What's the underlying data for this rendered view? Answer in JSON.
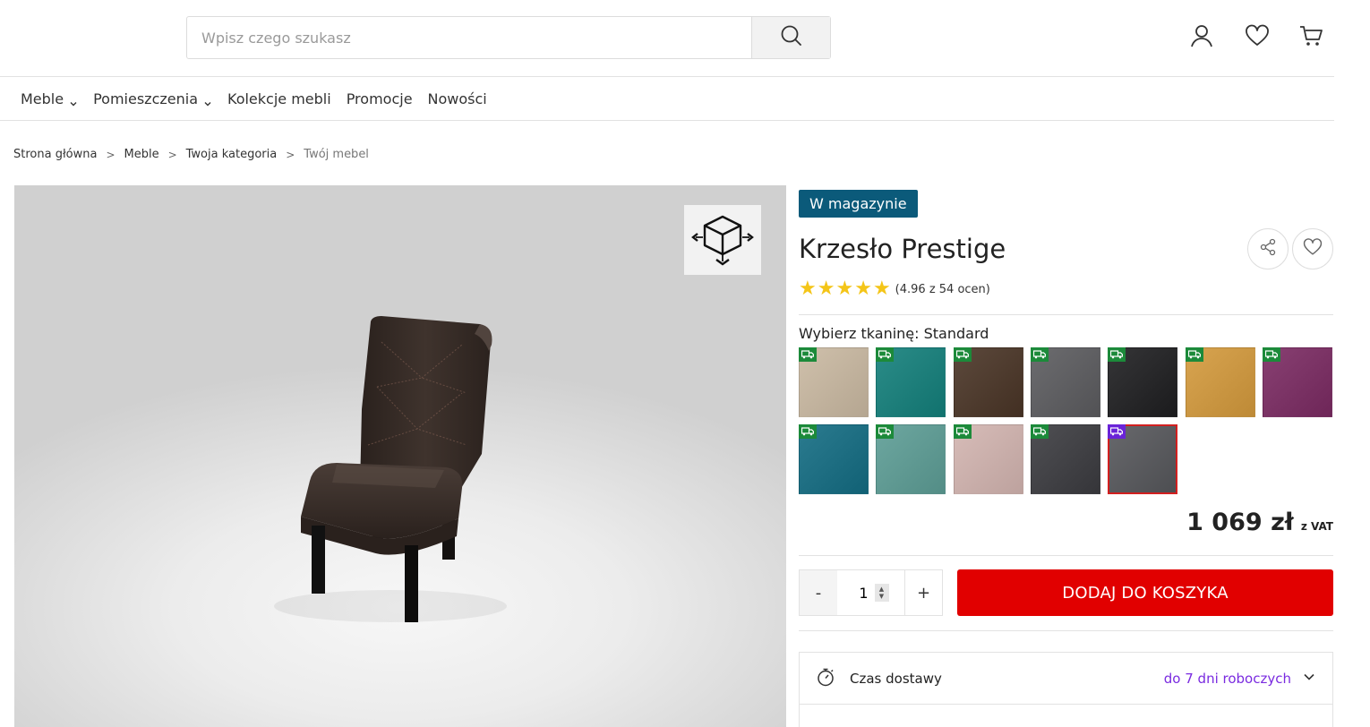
{
  "header": {
    "search_placeholder": "Wpisz czego szukasz",
    "icons": [
      "search-icon",
      "user-icon",
      "heart-icon",
      "cart-icon"
    ]
  },
  "nav": {
    "items": [
      {
        "label": "Meble",
        "has_dropdown": true
      },
      {
        "label": "Pomieszczenia",
        "has_dropdown": true
      },
      {
        "label": "Kolekcje mebli",
        "has_dropdown": false
      },
      {
        "label": "Promocje",
        "has_dropdown": false
      },
      {
        "label": "Nowości",
        "has_dropdown": false
      }
    ]
  },
  "breadcrumb": {
    "items": [
      "Strona główna",
      "Meble",
      "Twoja kategoria"
    ],
    "current": "Twój mebel",
    "separator": ">"
  },
  "viewer": {
    "mode_icon": "3d-cube-icon"
  },
  "product": {
    "stock_badge": "W magazynie",
    "title": "Krzesło Prestige",
    "rating_value": 4.96,
    "rating_stars": 5,
    "rating_text": "(4.96 z 54 ocen)",
    "fabric_label": "Wybierz tkaninę: Standard",
    "swatches": [
      {
        "color": "#c9b9a2"
      },
      {
        "color": "#137f7a"
      },
      {
        "color": "#4a3426"
      },
      {
        "color": "#5b5b5f"
      },
      {
        "color": "#1e1e20"
      },
      {
        "color": "#d49a3c"
      },
      {
        "color": "#7a2a62"
      },
      {
        "color": "#136c82"
      },
      {
        "color": "#5c9d95"
      },
      {
        "color": "#d2b4b0"
      },
      {
        "color": "#3b3b3f"
      },
      {
        "color": "#56575b",
        "selected": true
      }
    ],
    "price": "1 069 zł",
    "price_suffix": "z VAT",
    "quantity": "1",
    "qty_minus": "-",
    "qty_plus": "+",
    "add_to_cart": "DODAJ DO KOSZYKA",
    "delivery_label": "Czas dostawy",
    "delivery_value": "do 7 dni roboczych"
  },
  "colors": {
    "badge": "#0b5a7a",
    "cta": "#e10000",
    "star": "#f4c518",
    "delivery_accent": "#7a2be0",
    "swatch_tag": "#1c8a3a",
    "swatch_tag_selected": "#6a23d8"
  }
}
